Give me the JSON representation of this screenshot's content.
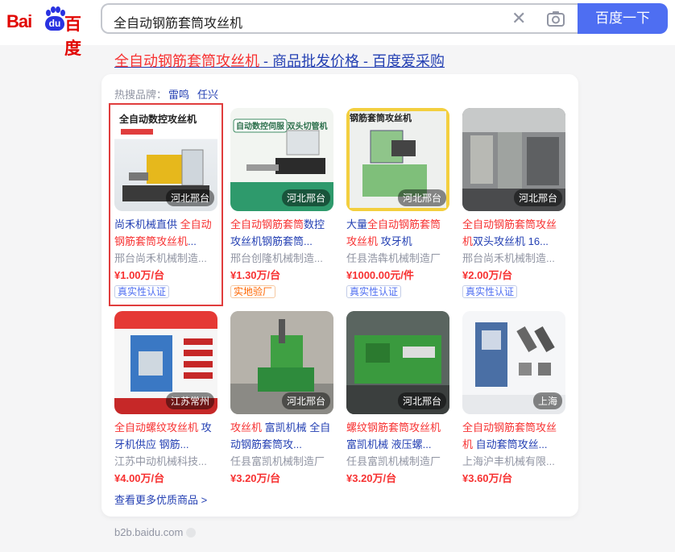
{
  "header": {
    "logo_text_left": "Bai",
    "logo_text_du": "du",
    "logo_text_cn": "百度",
    "search_query": "全自动钢筋套筒攻丝机",
    "search_button": "百度一下",
    "clear_icon": "close-icon",
    "camera_icon": "camera-icon"
  },
  "result": {
    "title_highlight": "全自动钢筋套筒攻丝机",
    "title_rest": " - 商品批发价格 - 百度爱采购",
    "hot_label": "热搜品牌：",
    "hot_brands": [
      "雷鸣",
      "任兴"
    ],
    "more_link": "查看更多优质商品 >",
    "source": "b2b.baidu.com"
  },
  "items": [
    {
      "location": "河北邢台",
      "title_plain_a": "尚禾机械直供 ",
      "title_hl_a": "全自动钢筋套筒攻丝机",
      "title_plain_b": "...",
      "shop": "邢台尚禾机械制造...",
      "price": "¥1.00万/台",
      "tag": "真实性认证",
      "tag_style": "blue",
      "img_caption": "全自动数控攻丝机"
    },
    {
      "location": "河北邢台",
      "title_plain_a": "",
      "title_hl_a": "全自动钢筋套筒",
      "title_plain_b": "数控攻丝机钢筋套筒...",
      "shop": "邢台创隆机械制造...",
      "price": "¥1.30万/台",
      "tag": "实地验厂",
      "tag_style": "orange",
      "img_caption": "自动数控伺服 双头切管机"
    },
    {
      "location": "河北邢台",
      "title_plain_a": "大量",
      "title_hl_a": "全自动钢筋套筒攻丝机",
      "title_plain_b": " 攻牙机",
      "shop": "任县浩犇机械制造厂",
      "price": "¥1000.00元/件",
      "tag": "真实性认证",
      "tag_style": "blue",
      "img_caption": "钢筋套筒攻丝机"
    },
    {
      "location": "河北邢台",
      "title_plain_a": "",
      "title_hl_a": "全自动钢筋套筒攻丝机",
      "title_plain_b": "双头攻丝机 16...",
      "shop": "邢台尚禾机械制造...",
      "price": "¥2.00万/台",
      "tag": "真实性认证",
      "tag_style": "blue",
      "img_caption": ""
    },
    {
      "location": "江苏常州",
      "title_plain_a": "",
      "title_hl_a": "全自动螺纹攻丝机",
      "title_plain_b": " 攻牙机供应 钢筋...",
      "shop": "江苏中动机械科技...",
      "price": "¥4.00万/台",
      "tag": "",
      "tag_style": "",
      "img_caption": ""
    },
    {
      "location": "河北邢台",
      "title_plain_a": "",
      "title_hl_a": "攻丝机",
      "title_plain_b": " 富凯机械 全自动钢筋套筒攻...",
      "shop": "任县富凯机械制造厂",
      "price": "¥3.20万/台",
      "tag": "",
      "tag_style": "",
      "img_caption": ""
    },
    {
      "location": "河北邢台",
      "title_plain_a": "",
      "title_hl_a": "螺纹钢筋套筒攻丝机",
      "title_plain_b": " 富凯机械 液压螺...",
      "shop": "任县富凯机械制造厂",
      "price": "¥3.20万/台",
      "tag": "",
      "tag_style": "",
      "img_caption": ""
    },
    {
      "location": "上海",
      "title_plain_a": "",
      "title_hl_a": "全自动钢筋套筒攻丝机",
      "title_plain_b": " 自动套筒攻丝...",
      "shop": "上海沪丰机械有限...",
      "price": "¥3.60万/台",
      "tag": "",
      "tag_style": "",
      "img_caption": ""
    }
  ],
  "colors": {
    "accent": "#4e6ef2",
    "link": "#2440b3",
    "highlight": "#f73131",
    "selected_border": "#e03d3d"
  }
}
